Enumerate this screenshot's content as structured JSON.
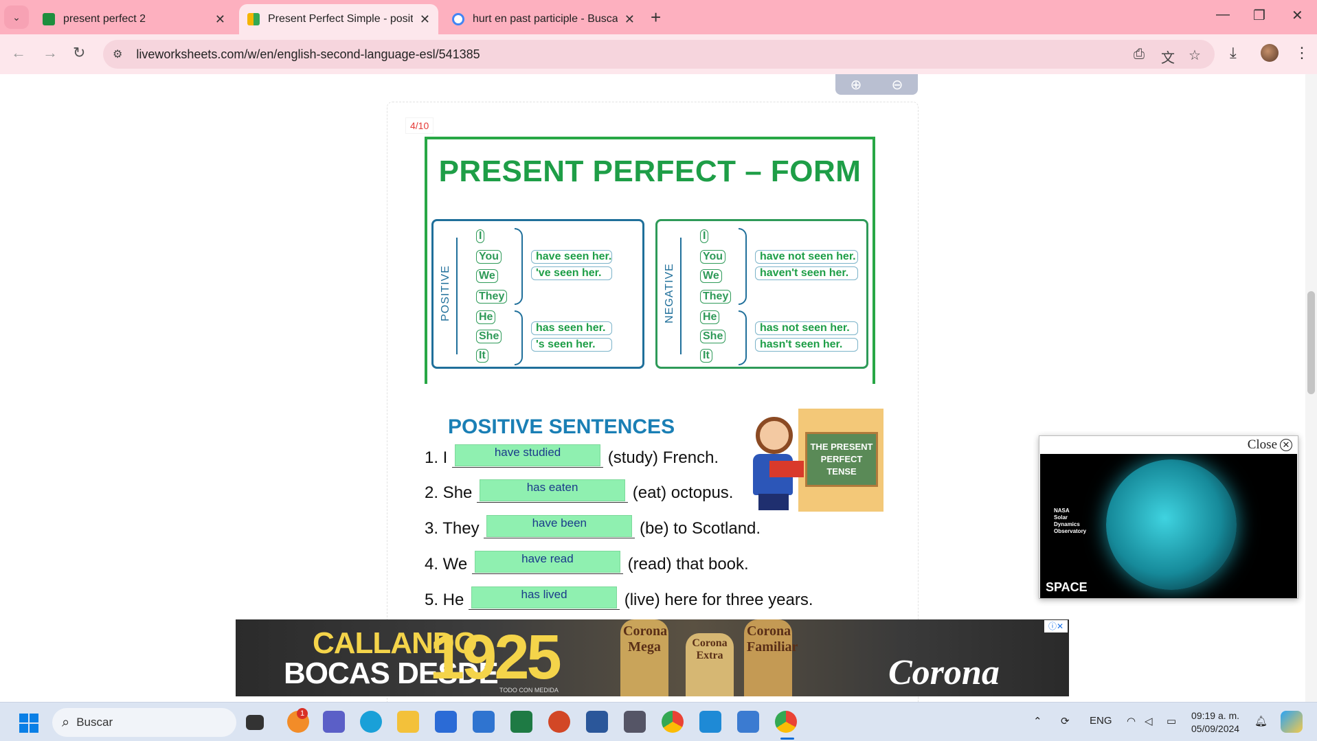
{
  "browser": {
    "tabs": [
      {
        "title": "present perfect 2",
        "active": false
      },
      {
        "title": "Present Perfect Simple - positiv",
        "active": true
      },
      {
        "title": "hurt en past participle - Buscar",
        "active": false
      }
    ],
    "url": "liveworksheets.com/w/en/english-second-language-esl/541385"
  },
  "worksheet": {
    "page_indicator": "4/10",
    "title": "PRESENT PERFECT – FORM",
    "positive_panel": {
      "label": "POSITIVE",
      "pronouns_group1": [
        "I",
        "You",
        "We",
        "They"
      ],
      "forms_group1": [
        "have seen her.",
        "'ve seen her."
      ],
      "pronouns_group2": [
        "He",
        "She",
        "It"
      ],
      "forms_group2": [
        "has seen her.",
        "'s seen her."
      ]
    },
    "negative_panel": {
      "label": "NEGATIVE",
      "pronouns_group1": [
        "I",
        "You",
        "We",
        "They"
      ],
      "forms_group1": [
        "have not seen her.",
        "haven't seen her."
      ],
      "pronouns_group2": [
        "He",
        "She",
        "It"
      ],
      "forms_group2": [
        "has not seen her.",
        "hasn't seen her."
      ]
    },
    "section_heading": "POSITIVE SENTENCES",
    "illustration_text": "THE PRESENT PERFECT TENSE",
    "sentences": [
      {
        "prefix": "1. I",
        "answer": "have studied",
        "suffix": "(study) French."
      },
      {
        "prefix": "2. She",
        "answer": "has eaten",
        "suffix": "(eat) octopus."
      },
      {
        "prefix": "3. They",
        "answer": "have been",
        "suffix": "(be) to Scotland."
      },
      {
        "prefix": "4. We",
        "answer": "have read",
        "suffix": "(read) that book."
      },
      {
        "prefix": "5. He",
        "answer": "has lived",
        "suffix": "(live) here for three years."
      }
    ]
  },
  "video_popup": {
    "close_label": "Close",
    "overlay_text": [
      "NASA",
      "Solar",
      "Dynamics",
      "Observatory"
    ],
    "brand": "SPACE"
  },
  "ad": {
    "line1": "CALLANDO",
    "line2": "BOCAS DESDE",
    "year": "1925",
    "fine_print": "TODO CON MEDIDA",
    "bottle_labels": [
      "Corona Mega",
      "Corona Extra",
      "Corona Familiar"
    ],
    "brand": "Corona"
  },
  "taskbar": {
    "search_placeholder": "Buscar",
    "notification_count": "1",
    "language": "ENG",
    "time": "09:19 a. m.",
    "date": "05/09/2024"
  }
}
